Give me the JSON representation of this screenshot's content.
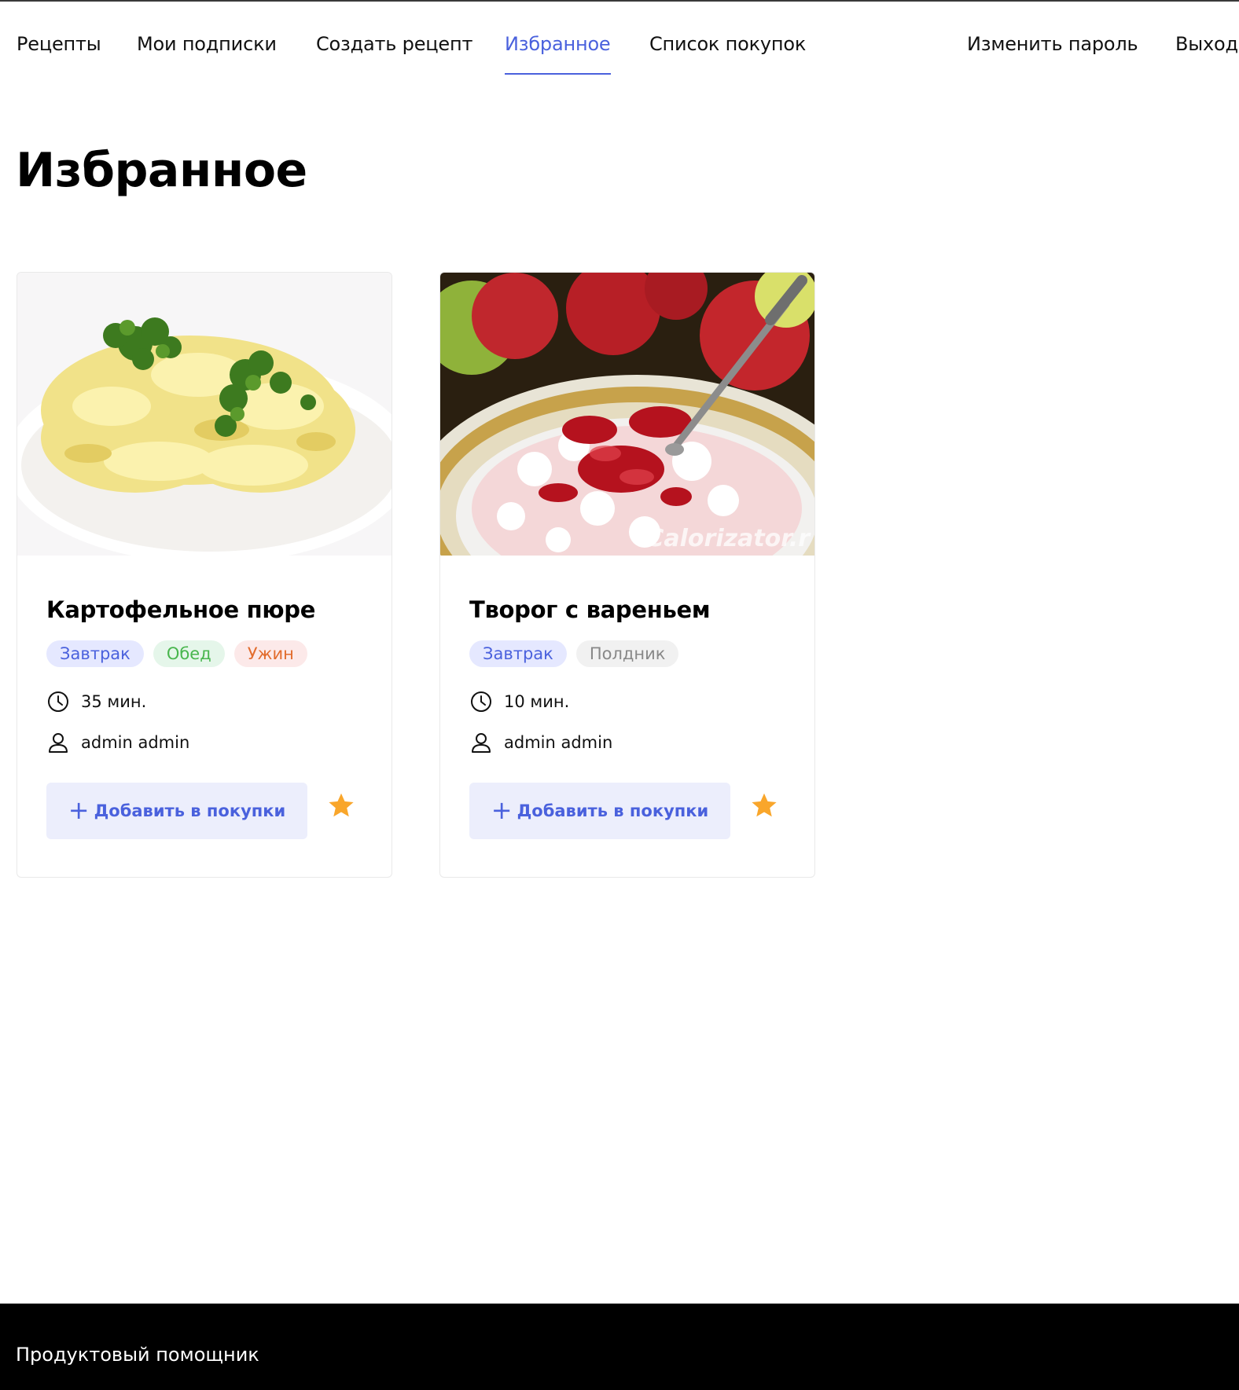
{
  "nav": {
    "items": [
      {
        "label": "Рецепты"
      },
      {
        "label": "Мои подписки"
      },
      {
        "label": "Создать рецепт"
      },
      {
        "label": "Избранное",
        "active": true
      },
      {
        "label": "Список покупок"
      }
    ],
    "right": [
      {
        "label": "Изменить пароль"
      },
      {
        "label": "Выход"
      }
    ]
  },
  "page": {
    "title": "Избранное"
  },
  "colors": {
    "accent": "#4A61DD",
    "button_bg": "#ECEEFC",
    "star": "#F9A62B"
  },
  "cards": [
    {
      "title": "Картофельное пюре",
      "tags": [
        {
          "label": "Завтрак",
          "color": "#4A61DD",
          "bg": "#E5E8FF"
        },
        {
          "label": "Обед",
          "color": "#49B64E",
          "bg": "#E5F6EA"
        },
        {
          "label": "Ужин",
          "color": "#E26C2D",
          "bg": "#FCE9E9"
        }
      ],
      "time": "35 мин.",
      "author": "admin admin",
      "add_button": "Добавить в покупки",
      "favorite": true,
      "time_icon": "clock-icon",
      "author_icon": "user-icon"
    },
    {
      "title": "Творог с вареньем",
      "tags": [
        {
          "label": "Завтрак",
          "color": "#4A61DD",
          "bg": "#E5E8FF"
        },
        {
          "label": "Полдник",
          "color": "#888888",
          "bg": "#F1F1F1"
        }
      ],
      "time": "10 мин.",
      "author": "admin admin",
      "add_button": "Добавить в покупки",
      "favorite": true,
      "image_watermark": "Calorizator.r",
      "time_icon": "clock-icon",
      "author_icon": "user-icon"
    }
  ],
  "footer": {
    "text": "Продуктовый помощник"
  }
}
